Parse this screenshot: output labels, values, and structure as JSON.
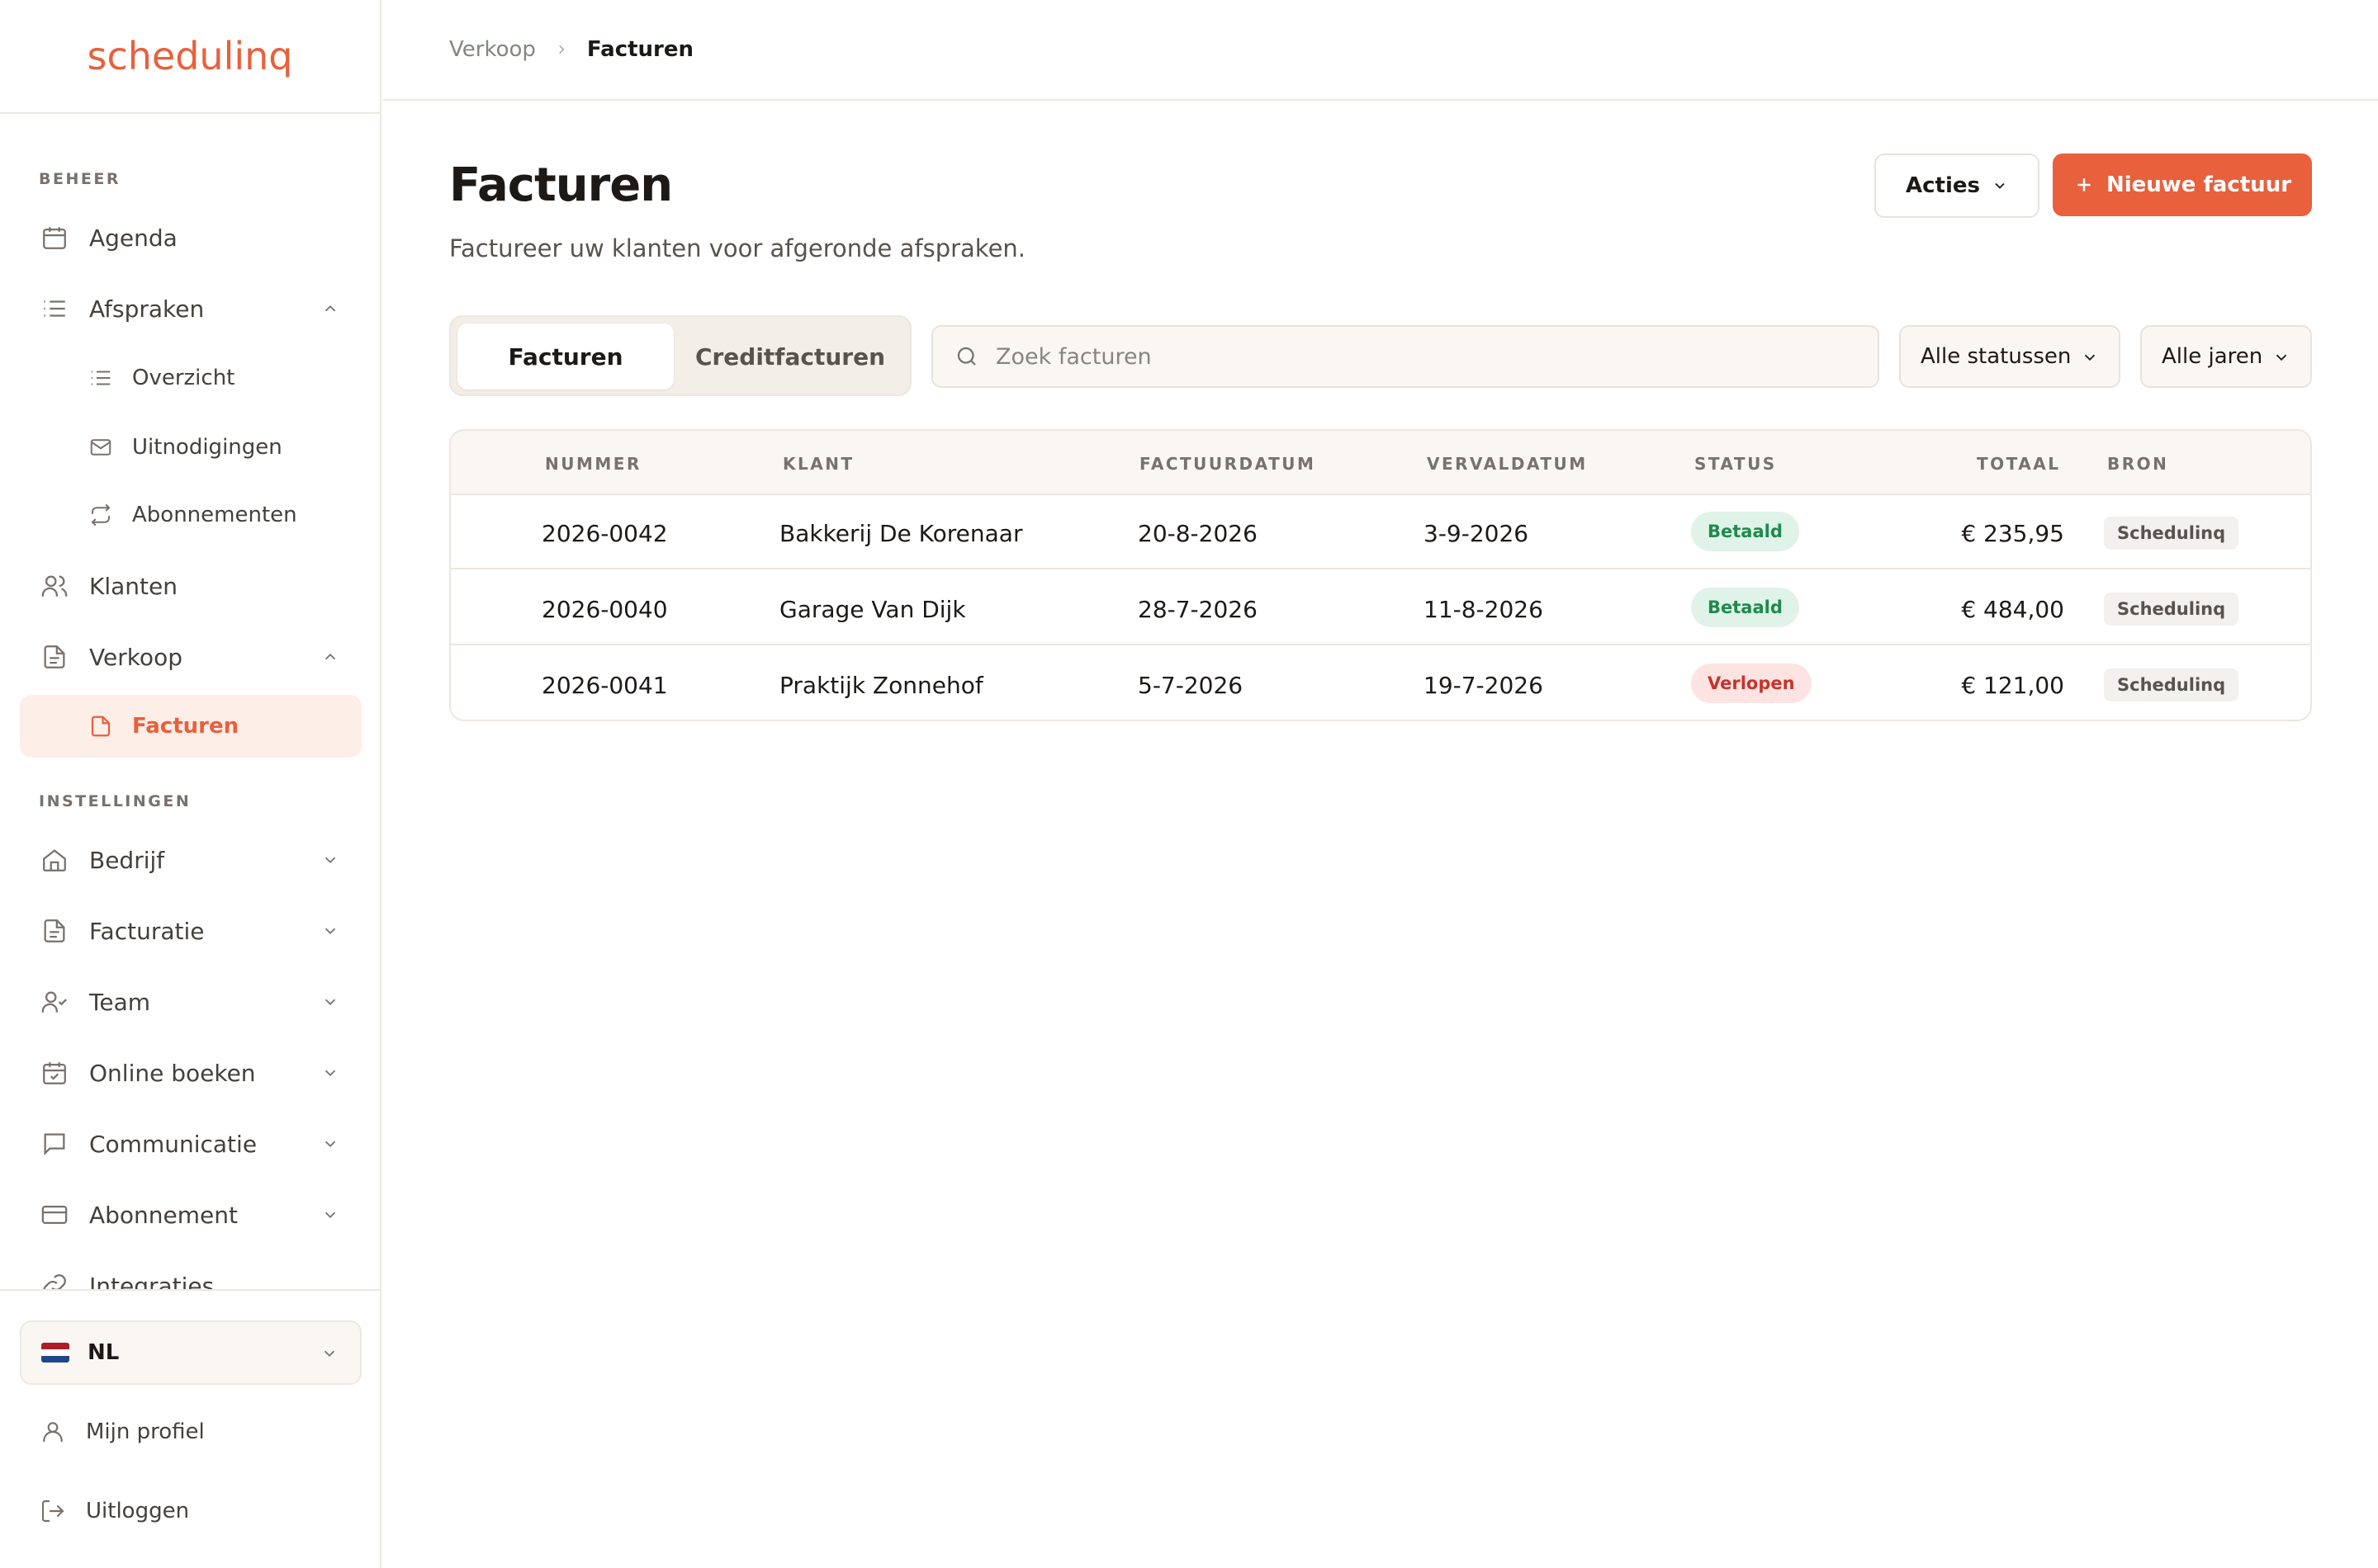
{
  "app": {
    "logo_text": "schedulinq",
    "brand_color": "#e8603c"
  },
  "sidebar": {
    "section_beheer": "BEHEER",
    "section_instellingen": "INSTELLINGEN",
    "items": [
      {
        "label": "Agenda",
        "icon": "calendar-icon"
      },
      {
        "label": "Afspraken",
        "icon": "list-icon"
      },
      {
        "label": "Overzicht",
        "icon": "list-icon"
      },
      {
        "label": "Uitnodigingen",
        "icon": "mail-icon"
      },
      {
        "label": "Abonnementen",
        "icon": "repeat-icon"
      },
      {
        "label": "Klanten",
        "icon": "users-icon"
      },
      {
        "label": "Verkoop",
        "icon": "document-icon"
      },
      {
        "label": "Facturen",
        "icon": "document-icon"
      },
      {
        "label": "Bedrijf",
        "icon": "home-icon"
      },
      {
        "label": "Facturatie",
        "icon": "document-icon"
      },
      {
        "label": "Team",
        "icon": "user-check-icon"
      },
      {
        "label": "Online boeken",
        "icon": "calendar-check-icon"
      },
      {
        "label": "Communicatie",
        "icon": "chat-icon"
      },
      {
        "label": "Abonnement",
        "icon": "credit-card-icon"
      },
      {
        "label": "Integraties",
        "icon": "link-icon"
      }
    ],
    "language": "NL",
    "profile": "Mijn profiel",
    "logout": "Uitloggen"
  },
  "breadcrumb": {
    "parent": "Verkoop",
    "current": "Facturen"
  },
  "page": {
    "title": "Facturen",
    "subtitle": "Factureer uw klanten voor afgeronde afspraken.",
    "actions_label": "Acties",
    "new_invoice_label": "Nieuwe factuur"
  },
  "tabs": {
    "invoices": "Facturen",
    "credit": "Creditfacturen"
  },
  "filters": {
    "search_placeholder": "Zoek facturen",
    "status": "Alle statussen",
    "year": "Alle jaren"
  },
  "table": {
    "headers": {
      "number": "NUMMER",
      "client": "KLANT",
      "invoice_date": "FACTUURDATUM",
      "due_date": "VERVALDATUM",
      "status": "STATUS",
      "total": "TOTAAL",
      "source": "BRON"
    },
    "rows": [
      {
        "number": "2026-0042",
        "client": "Bakkerij De Korenaar",
        "invoice_date": "20-8-2026",
        "due_date": "3-9-2026",
        "status": "Betaald",
        "total": "€ 235,95",
        "source": "Schedulinq"
      },
      {
        "number": "2026-0040",
        "client": "Garage Van Dijk",
        "invoice_date": "28-7-2026",
        "due_date": "11-8-2026",
        "status": "Betaald",
        "total": "€ 484,00",
        "source": "Schedulinq"
      },
      {
        "number": "2026-0041",
        "client": "Praktijk Zonnehof",
        "invoice_date": "5-7-2026",
        "due_date": "19-7-2026",
        "status": "Verlopen",
        "total": "€ 121,00",
        "source": "Schedulinq"
      }
    ]
  }
}
